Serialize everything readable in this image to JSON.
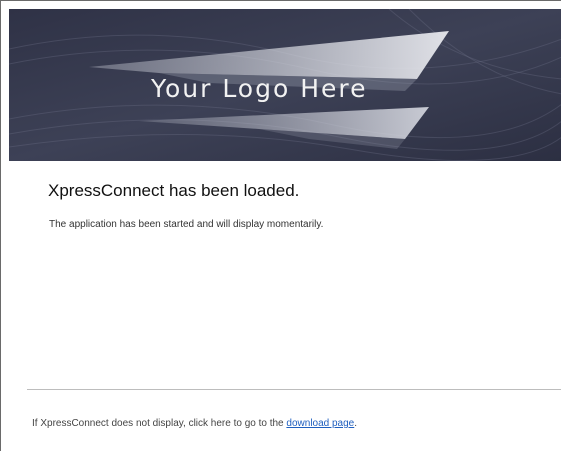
{
  "banner": {
    "logo_text": "Your Logo Here"
  },
  "main": {
    "heading": "XpressConnect has been loaded.",
    "message": "The application has been started and will display momentarily."
  },
  "footer": {
    "prefix_text": "If XpressConnect does not display, click here to go to the",
    "link_text": "download page",
    "suffix_text": "."
  },
  "colors": {
    "banner_background": "#3a3e52",
    "link": "#1f5fbf"
  }
}
